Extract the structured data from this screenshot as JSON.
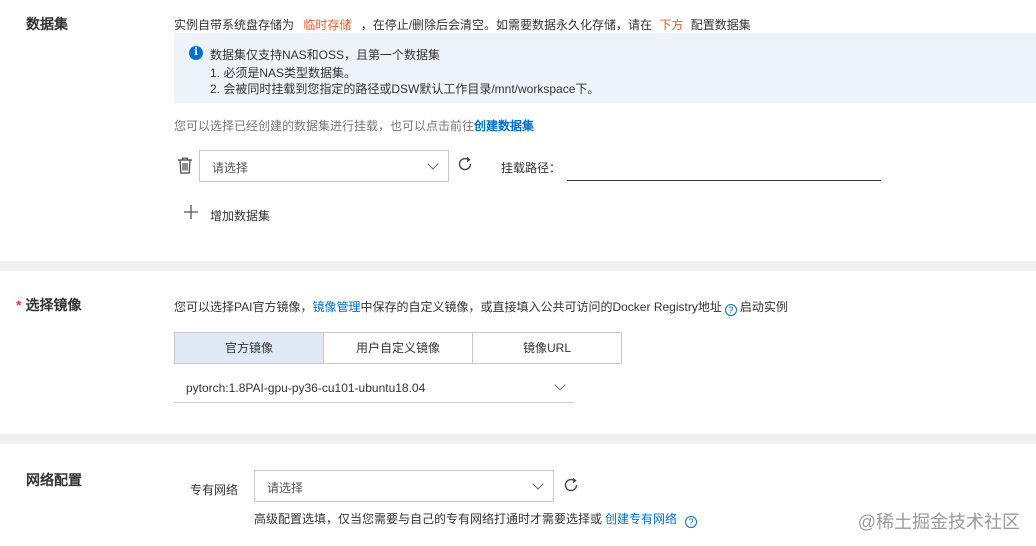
{
  "dataset": {
    "title": "数据集",
    "desc_prefix": "实例自带系统盘存储为",
    "desc_highlight1": "临时存储",
    "desc_middle": "，在停止/删除后会清空。如需要数据永久化存储，请在",
    "desc_highlight2": "下方",
    "desc_suffix": "配置数据集",
    "info_title": "数据集仅支持NAS和OSS，且第一个数据集",
    "info_line1": "1. 必须是NAS类型数据集。",
    "info_line2": "2. 会被同时挂载到您指定的路径或DSW默认工作目录/mnt/workspace下。",
    "hint_prefix": "您可以选择已经创建的数据集进行挂载，也可以点击前往",
    "hint_link": "创建数据集",
    "select_placeholder": "请选择",
    "mount_path_label": "挂载路径：",
    "mount_path_value": "",
    "add_label": "增加数据集"
  },
  "image": {
    "required_mark": "*",
    "title": "选择镜像",
    "desc_prefix": "您可以选择PAI官方镜像，",
    "desc_link": "镜像管理",
    "desc_middle": "中保存的自定义镜像，或直接填入公共可访问的Docker Registry地址",
    "desc_suffix": "启动实例",
    "tabs": [
      "官方镜像",
      "用户自定义镜像",
      "镜像URL"
    ],
    "active_tab": 0,
    "selected": "pytorch:1.8PAI-gpu-py36-cu101-ubuntu18.04"
  },
  "network": {
    "title": "网络配置",
    "vpc_label": "专有网络",
    "select_placeholder": "请选择",
    "hint_prefix": "高级配置选填，仅当您需要与自己的专有网络打通时才需要选择或",
    "hint_link": "创建专有网络"
  },
  "watermark": "@稀土掘金技术社区",
  "colors": {
    "accent": "#0070cc",
    "highlight": "#ee5b2b",
    "info_bg": "#eef3f9",
    "active_tab_bg": "#dfeaf6"
  }
}
